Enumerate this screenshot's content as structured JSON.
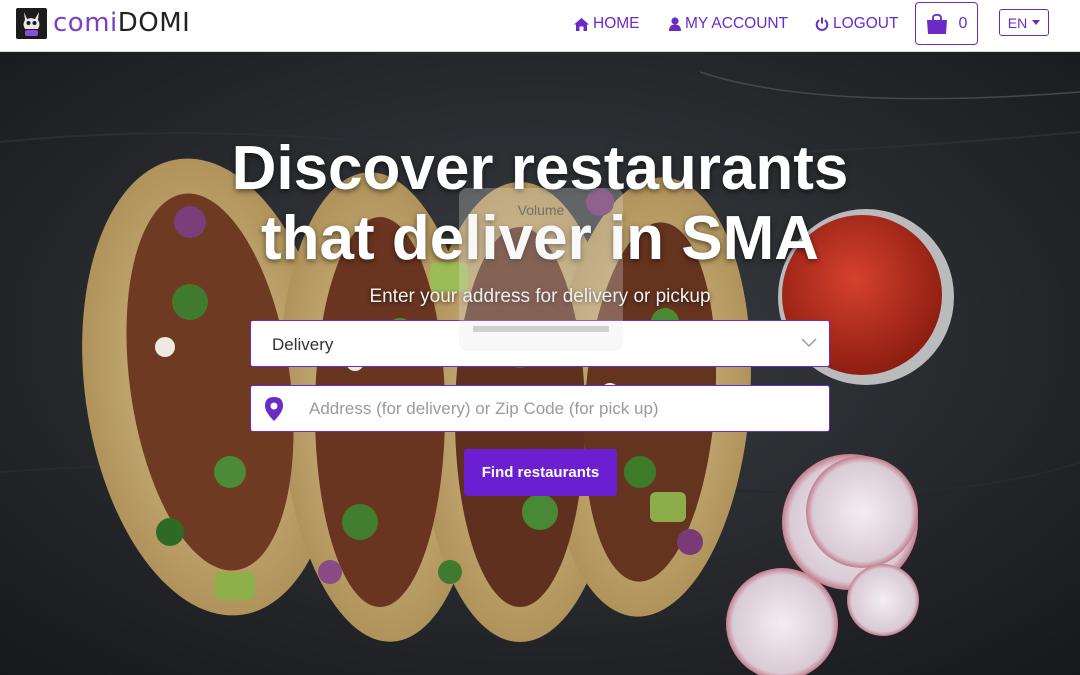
{
  "brand": {
    "name_light": "comi",
    "name_dark": "DOMI"
  },
  "nav": {
    "home": "HOME",
    "account": "MY ACCOUNT",
    "logout": "LOGOUT",
    "cart_count": "0",
    "language": "EN"
  },
  "hero": {
    "title_line1": "Discover restaurants",
    "title_line2": "that deliver in SMA",
    "subtitle": "Enter your address for delivery or pickup",
    "mode_select_value": "Delivery",
    "address_placeholder": "Address (for delivery) or Zip Code (for pick up)",
    "find_button": "Find restaurants"
  },
  "overlay": {
    "volume_label": "Volume",
    "volume_level": 0
  },
  "colors": {
    "accent": "#6a2bc7",
    "button": "#6a1fd1"
  }
}
